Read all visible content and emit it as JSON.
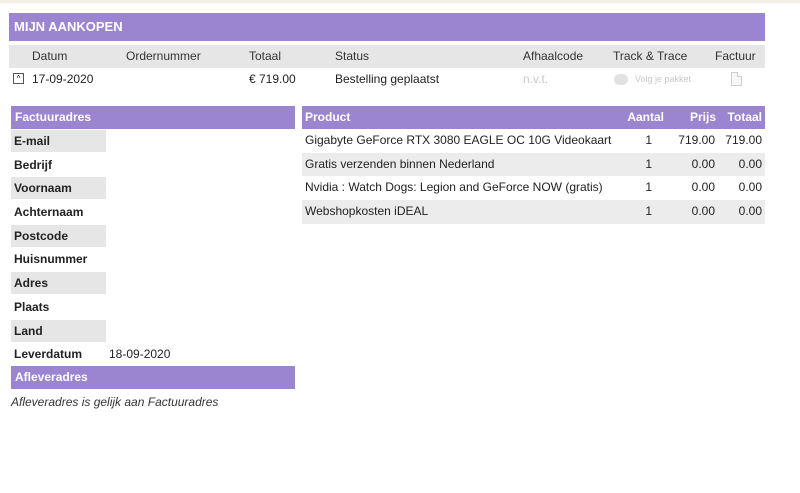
{
  "page": {
    "title": "MIJN AANKOPEN"
  },
  "orders": {
    "columns": [
      "Datum",
      "Ordernummer",
      "Totaal",
      "Status",
      "Afhaalcode",
      "Track & Trace",
      "Factuur"
    ],
    "rows": [
      {
        "datum": "17-09-2020",
        "ordernummer": "",
        "totaal": "€ 719.00",
        "status": "Bestelling geplaatst",
        "afhaalcode": "n.v.t.",
        "track_trace": "Volg je pakket",
        "toggle": "^"
      }
    ]
  },
  "billing": {
    "title": "Factuuradres",
    "fields": [
      {
        "label": "E-mail",
        "value": ""
      },
      {
        "label": "Bedrijf",
        "value": ""
      },
      {
        "label": "Voornaam",
        "value": ""
      },
      {
        "label": "Achternaam",
        "value": ""
      },
      {
        "label": "Postcode",
        "value": ""
      },
      {
        "label": "Huisnummer",
        "value": ""
      },
      {
        "label": "Adres",
        "value": ""
      },
      {
        "label": "Plaats",
        "value": ""
      },
      {
        "label": "Land",
        "value": ""
      },
      {
        "label": "Leverdatum",
        "value": "18-09-2020"
      }
    ]
  },
  "delivery": {
    "title": "Afleveradres",
    "note": "Afleveradres is gelijk aan Factuuradres"
  },
  "products": {
    "columns": {
      "product": "Product",
      "aantal": "Aantal",
      "prijs": "Prijs",
      "totaal": "Totaal"
    },
    "rows": [
      {
        "name": "Gigabyte GeForce RTX 3080 EAGLE OC 10G Videokaart",
        "qty": "1",
        "price": "719.00",
        "total": "719.00"
      },
      {
        "name": "Gratis verzenden binnen Nederland",
        "qty": "1",
        "price": "0.00",
        "total": "0.00"
      },
      {
        "name": "Nvidia : Watch Dogs: Legion and GeForce NOW (gratis)",
        "qty": "1",
        "price": "0.00",
        "total": "0.00"
      },
      {
        "name": "Webshopkosten iDEAL",
        "qty": "1",
        "price": "0.00",
        "total": "0.00"
      }
    ]
  },
  "colors": {
    "accent": "#9b84d0",
    "row_shade": "#e6e6e6"
  }
}
